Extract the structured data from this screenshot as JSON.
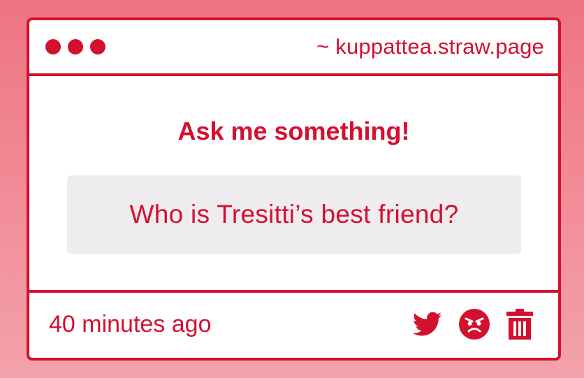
{
  "window": {
    "url": "~ kuppattea.straw.page"
  },
  "main": {
    "prompt": "Ask me something!",
    "question": "Who is Tresitti’s best friend?"
  },
  "footer": {
    "timestamp": "40 minutes ago",
    "actions": [
      {
        "icon": "twitter-icon"
      },
      {
        "icon": "angry-face-icon"
      },
      {
        "icon": "trash-icon"
      }
    ]
  },
  "colors": {
    "accent": "#d4102f",
    "background_top": "#ee7482",
    "background_bottom": "#f3a2ab",
    "question_box": "#eeecee"
  }
}
